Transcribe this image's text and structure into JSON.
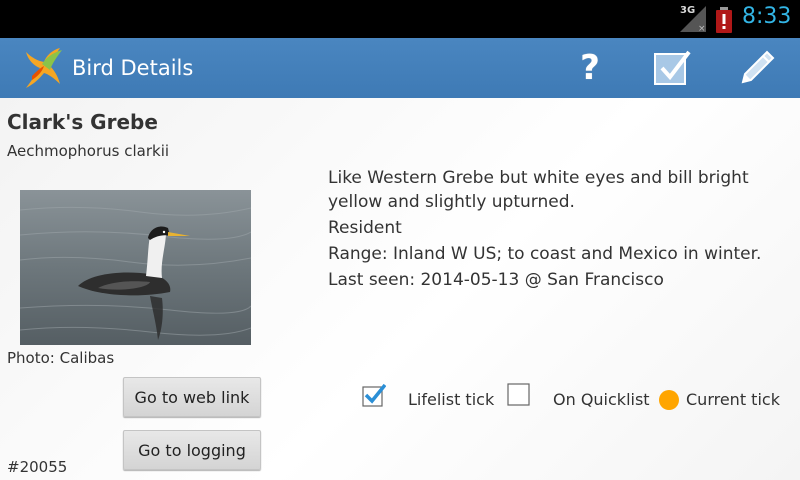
{
  "status_bar": {
    "network": "3G",
    "time": "8:33",
    "icons": [
      "signal-3g-icon",
      "battery-alert-icon"
    ]
  },
  "action_bar": {
    "title": "Bird Details",
    "icons": [
      "app-bird-logo-icon",
      "help-icon",
      "checklist-icon",
      "edit-pencil-icon"
    ]
  },
  "bird": {
    "common_name": "Clark's Grebe",
    "latin_name": "Aechmophorus clarkii",
    "photo_credit": "Photo: Calibas",
    "description": [
      "Like Western Grebe but white eyes and bill bright yellow and slightly upturned.",
      "Resident",
      "Range: Inland W US; to coast and Mexico in winter.",
      "Last seen: 2014-05-13 @ San Francisco"
    ],
    "record_id": "#20055"
  },
  "buttons": {
    "web_link": "Go to web link",
    "logging": "Go to logging"
  },
  "ticks": {
    "lifelist": {
      "label": "Lifelist tick",
      "checked": true
    },
    "quicklist": {
      "label": "On Quicklist",
      "checked": false
    },
    "current": {
      "label": "Current tick",
      "color": "#ffa500"
    }
  },
  "colors": {
    "action_bar": "#4a86c0",
    "status_time": "#33b5e5",
    "checkmark": "#2b8fd6"
  }
}
